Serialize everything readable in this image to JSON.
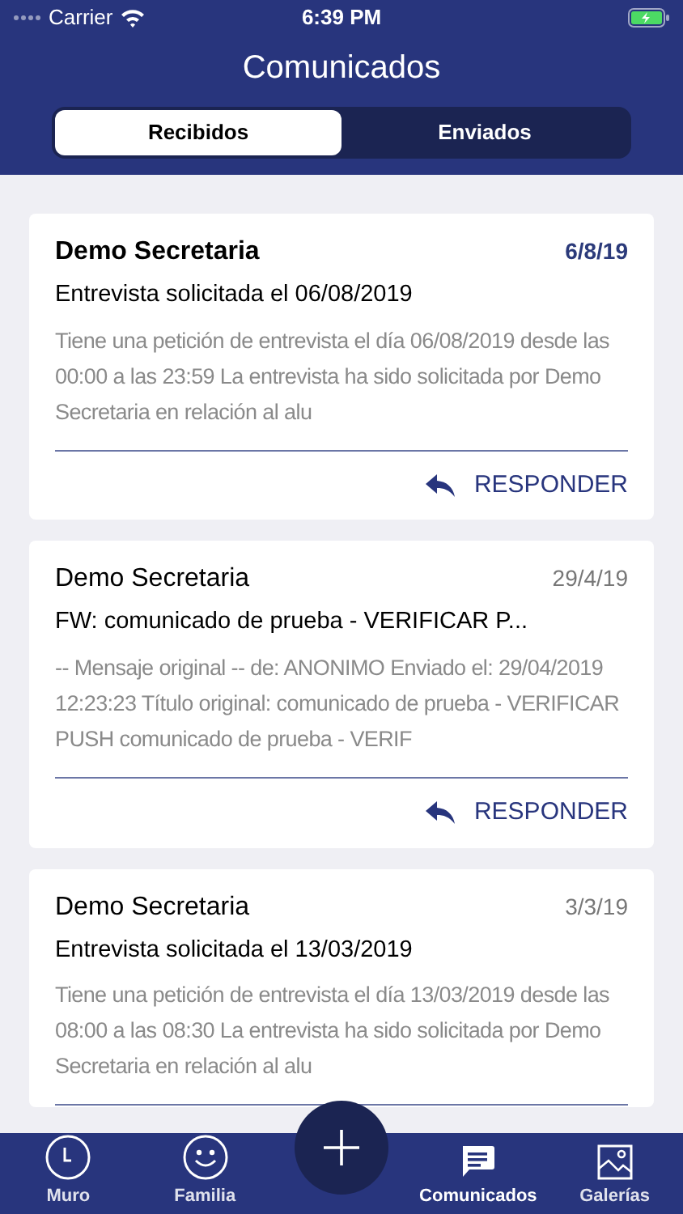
{
  "status_bar": {
    "carrier": "Carrier",
    "time": "6:39 PM"
  },
  "title": "Comunicados",
  "tabs": [
    {
      "label": "Recibidos",
      "selected": true
    },
    {
      "label": "Enviados",
      "selected": false
    }
  ],
  "messages": [
    {
      "sender": "Demo Secretaria",
      "date": "6/8/19",
      "unread": true,
      "subject": "Entrevista solicitada el 06/08/2019",
      "preview": "Tiene una petición de entrevista el día 06/08/2019 desde las 00:00 a las 23:59 La entrevista ha sido solicitada por Demo Secretaria en relación al alu",
      "action": "RESPONDER"
    },
    {
      "sender": "Demo Secretaria",
      "date": "29/4/19",
      "unread": false,
      "subject": "FW: comunicado de prueba  - VERIFICAR P...",
      "preview": "-- Mensaje original -- de: ANONIMO Enviado el: 29/04/2019 12:23:23 Título original: comunicado de prueba - VERIFICAR PUSH comunicado de prueba - VERIF",
      "action": "RESPONDER"
    },
    {
      "sender": "Demo Secretaria",
      "date": "3/3/19",
      "unread": false,
      "subject": "Entrevista solicitada el 13/03/2019",
      "preview": "Tiene una petición de entrevista el día 13/03/2019 desde las 08:00 a las 08:30 La entrevista ha sido solicitada por Demo Secretaria en relación al alu"
    }
  ],
  "tab_bar": [
    {
      "label": "Muro",
      "kind": "clock",
      "selected": false
    },
    {
      "label": "Familia",
      "kind": "smiley",
      "selected": false
    },
    {
      "kind": "add"
    },
    {
      "label": "Comunicados",
      "kind": "chat",
      "selected": true
    },
    {
      "label": "Galerías",
      "kind": "gallery",
      "selected": false
    }
  ]
}
